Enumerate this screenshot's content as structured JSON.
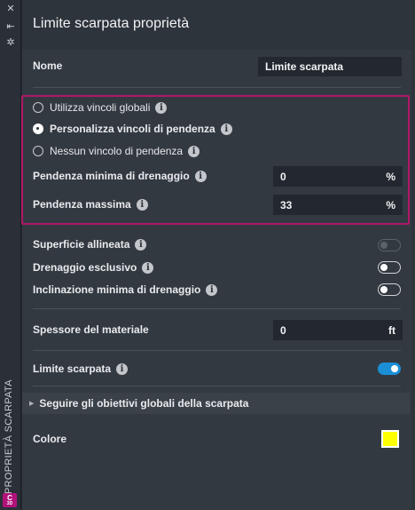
{
  "sidebar": {
    "close_icon": "close-icon",
    "collapse_icon": "collapse-icon",
    "settings_icon": "gear-icon",
    "vertical_label": "PROPRIETÀ SCARPATA",
    "badge_letter": "C",
    "badge_sub": "3D"
  },
  "header": {
    "title": "Limite scarpata proprietà"
  },
  "name": {
    "label": "Nome",
    "value": "Limite scarpata"
  },
  "slope_constraints": {
    "options": [
      {
        "label": "Utilizza vincoli globali",
        "selected": false
      },
      {
        "label": "Personalizza vincoli di pendenza",
        "selected": true
      },
      {
        "label": "Nessun vincolo di pendenza",
        "selected": false
      }
    ],
    "min_drain": {
      "label": "Pendenza minima di drenaggio",
      "value": "0",
      "unit": "%"
    },
    "max_slope": {
      "label": "Pendenza massima",
      "value": "33",
      "unit": "%"
    }
  },
  "toggles": {
    "aligned_surface": {
      "label": "Superficie allineata",
      "state": "disabled"
    },
    "exclusive_drain": {
      "label": "Drenaggio esclusivo",
      "state": "off"
    },
    "min_drain_slope": {
      "label": "Inclinazione minima di drenaggio",
      "state": "off"
    }
  },
  "material_thickness": {
    "label": "Spessore del materiale",
    "value": "0",
    "unit": "ft"
  },
  "slope_limit": {
    "label": "Limite scarpata",
    "state": "on"
  },
  "global_targets": {
    "label": "Seguire gli obiettivi globali della scarpata"
  },
  "color": {
    "label": "Colore",
    "value": "#ffff00"
  },
  "info_glyph": "i"
}
